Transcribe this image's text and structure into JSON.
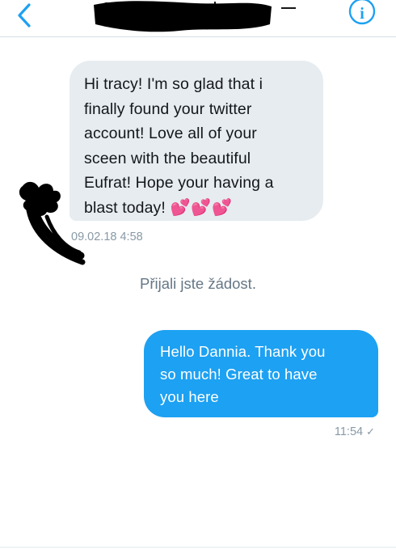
{
  "header": {
    "back_icon": "chevron-left-icon",
    "info_icon": "info-circle-icon",
    "info_glyph": "i",
    "accent_color": "#1da1f2"
  },
  "messages": {
    "incoming": {
      "lines": [
        "Hi tracy! I'm so glad that i",
        "finally found your twitter",
        "account! Love all of your",
        "sceen with the beautiful",
        "Eufrat! Hope your having a",
        "blast today!"
      ],
      "emoji": "💕💕💕",
      "timestamp": "09.02.18 4:58",
      "bubble_color": "#e6ecf0"
    },
    "system_notice": "Přijali jste žádost.",
    "outgoing": {
      "lines": [
        "Hello Dannia. Thank you",
        "so much! Great to have",
        "you here"
      ],
      "timestamp": "11:54",
      "status_icon": "checkmark-icon",
      "status_glyph": "✓",
      "bubble_color": "#1da1f2"
    }
  }
}
